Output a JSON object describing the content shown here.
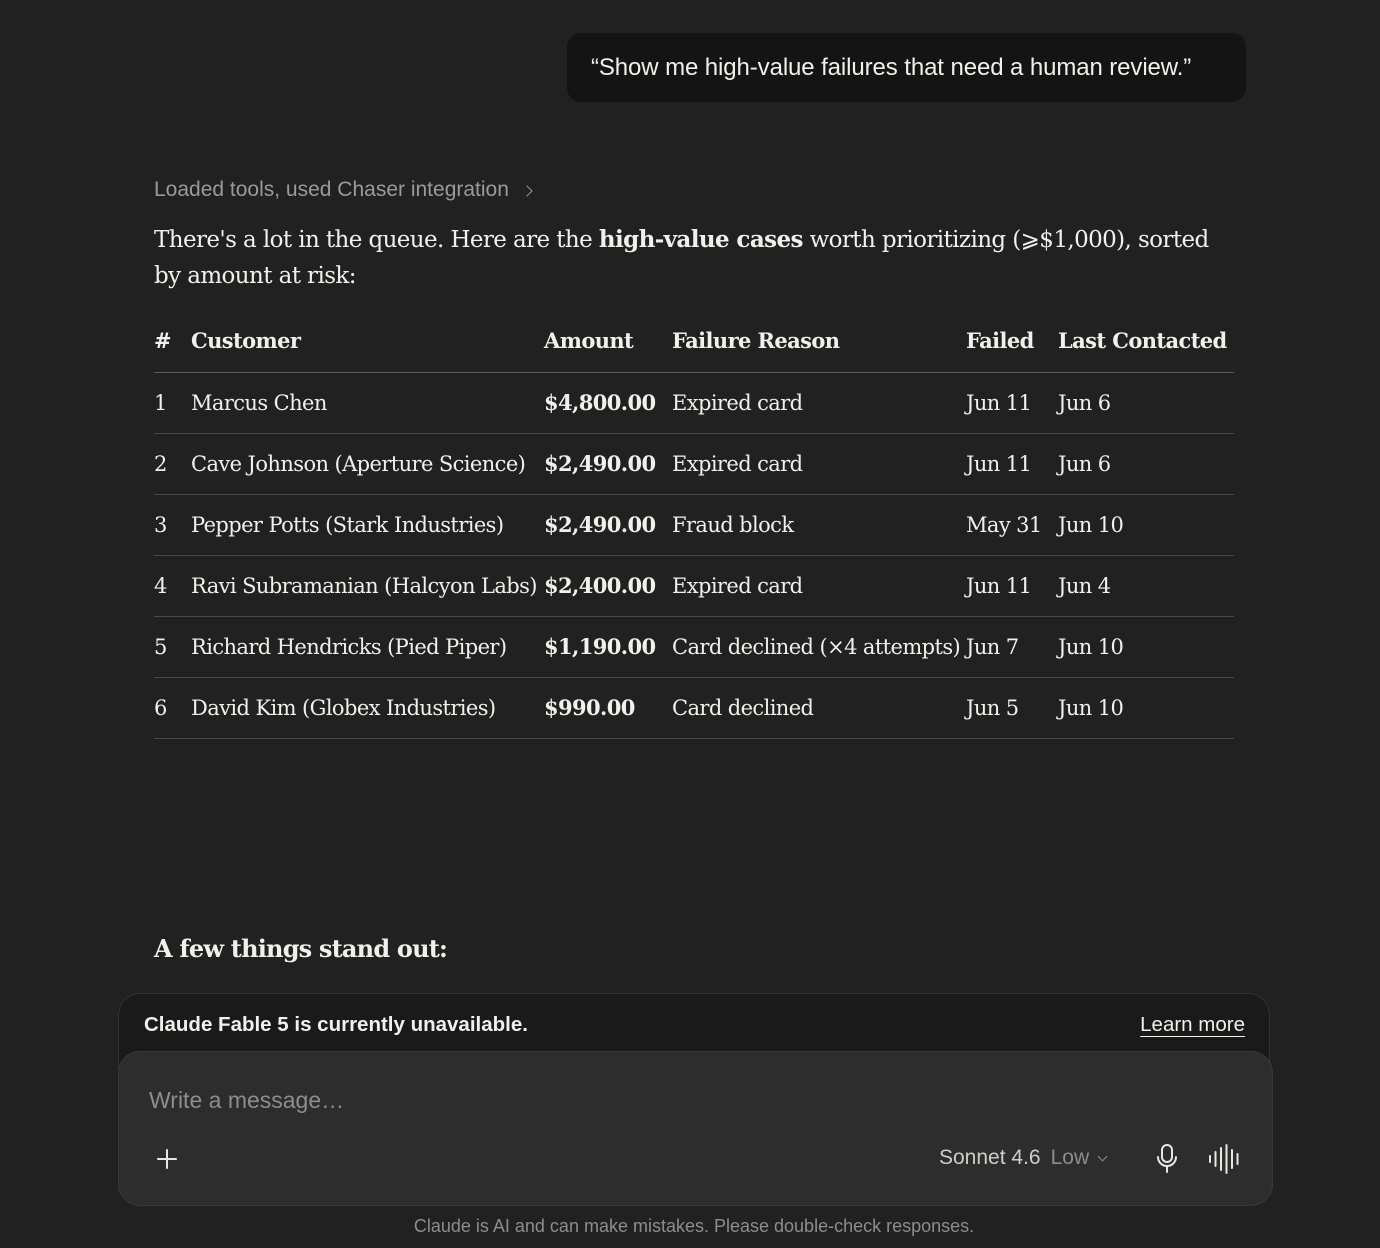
{
  "user_message": "“Show me high-value failures that need a human review.”",
  "tools_line": "Loaded tools, used Chaser integration",
  "intro": {
    "before": "There's a lot in the queue. Here are the ",
    "bold": "high-value cases",
    "after": " worth prioritizing (⩾$1,000), sorted by amount at risk:"
  },
  "table": {
    "headers": {
      "num": "#",
      "customer": "Customer",
      "amount": "Amount",
      "reason": "Failure Reason",
      "failed": "Failed",
      "last": "Last Contacted"
    },
    "rows": [
      {
        "num": "1",
        "customer": "Marcus Chen",
        "amount": "$4,800.00",
        "reason": "Expired card",
        "failed": "Jun 11",
        "last": "Jun 6"
      },
      {
        "num": "2",
        "customer": "Cave Johnson (Aperture Science)",
        "amount": "$2,490.00",
        "reason": "Expired card",
        "failed": "Jun 11",
        "last": "Jun 6"
      },
      {
        "num": "3",
        "customer": "Pepper Potts (Stark Industries)",
        "amount": "$2,490.00",
        "reason": "Fraud block",
        "failed": "May 31",
        "last": "Jun 10"
      },
      {
        "num": "4",
        "customer": "Ravi Subramanian (Halcyon Labs)",
        "amount": "$2,400.00",
        "reason": "Expired card",
        "failed": "Jun 11",
        "last": "Jun 4"
      },
      {
        "num": "5",
        "customer": "Richard Hendricks (Pied Piper)",
        "amount": "$1,190.00",
        "reason": "Card declined (×4 attempts)",
        "failed": "Jun 7",
        "last": "Jun 10"
      },
      {
        "num": "6",
        "customer": "David Kim (Globex Industries)",
        "amount": "$990.00",
        "reason": "Card declined",
        "failed": "Jun 5",
        "last": "Jun 10"
      }
    ]
  },
  "standout_heading": "A few things stand out:",
  "notice": {
    "message": "Claude Fable 5 is currently unavailable.",
    "link": "Learn more"
  },
  "composer": {
    "placeholder": "Write a message…",
    "model": "Sonnet 4.6",
    "effort": "Low",
    "icons": [
      "plus-icon",
      "chevron-down-icon",
      "microphone-icon",
      "voice-waveform-icon"
    ]
  },
  "disclaimer": "Claude is AI and can make mistakes. Please double-check responses.",
  "colors": {
    "background": "#212121",
    "user_bubble": "#141414",
    "composer": "#2d2d2d",
    "notice_bar": "#1a1a1a",
    "text": "#f2f0ea",
    "muted": "#9b9a95"
  }
}
